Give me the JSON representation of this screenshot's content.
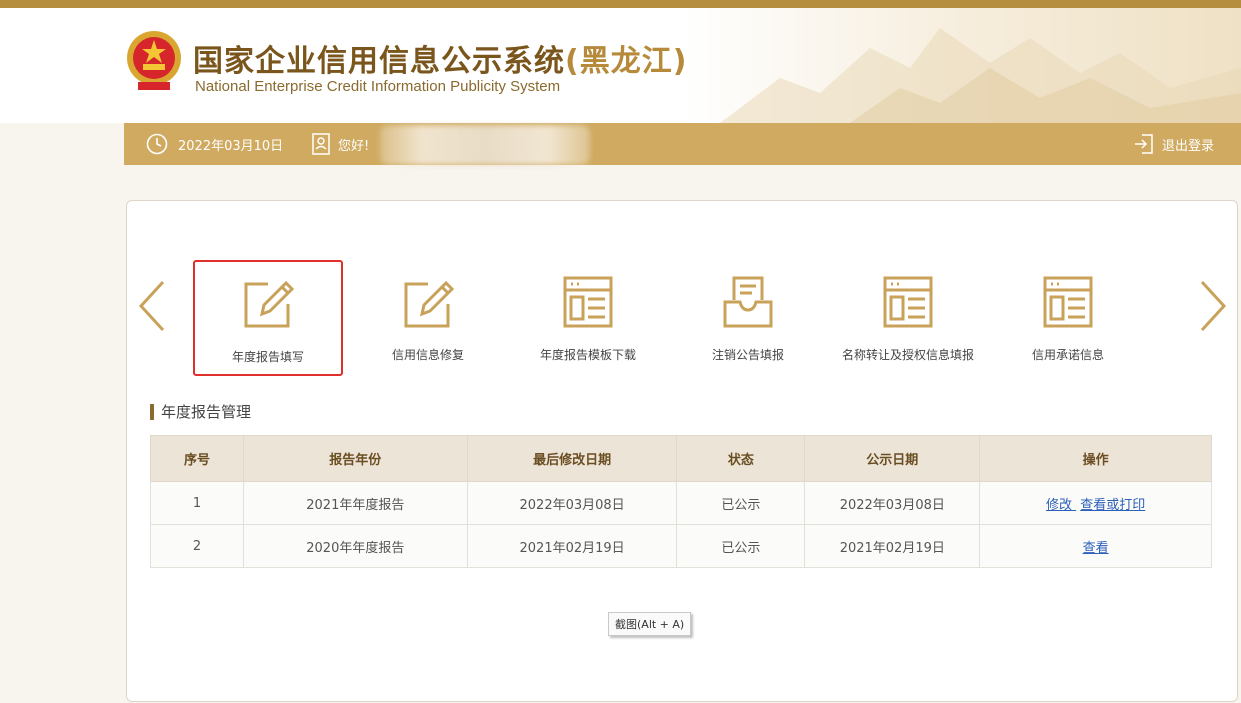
{
  "header": {
    "title_main": "国家企业信用信息公示系统",
    "title_region": "(黑龙江)",
    "title_en": "National Enterprise Credit Information Publicity System"
  },
  "topbar": {
    "date": "2022年03月10日",
    "greeting": "您好!",
    "logout_label": "退出登录"
  },
  "nav": {
    "items": [
      {
        "label": "年度报告填写",
        "icon": "pencil-edit-icon",
        "active": true
      },
      {
        "label": "信用信息修复",
        "icon": "pencil-edit-icon"
      },
      {
        "label": "年度报告模板下载",
        "icon": "document-template-icon"
      },
      {
        "label": "注销公告填报",
        "icon": "inbox-tray-icon"
      },
      {
        "label": "名称转让及授权信息填报",
        "icon": "document-template-icon"
      },
      {
        "label": "信用承诺信息",
        "icon": "document-template-icon"
      }
    ]
  },
  "section": {
    "title": "年度报告管理"
  },
  "table": {
    "headers": [
      "序号",
      "报告年份",
      "最后修改日期",
      "状态",
      "公示日期",
      "操作"
    ],
    "rows": [
      {
        "no": "1",
        "year": "2021年年度报告",
        "modified": "2022年03月08日",
        "status": "已公示",
        "published": "2022年03月08日",
        "actions": [
          "修改",
          "查看或打印"
        ]
      },
      {
        "no": "2",
        "year": "2020年年度报告",
        "modified": "2021年02月19日",
        "status": "已公示",
        "published": "2021年02月19日",
        "actions": [
          "查看"
        ]
      }
    ]
  },
  "tooltip": {
    "text": "截图(Alt + A)"
  },
  "colors": {
    "gold": "#cfaa60",
    "brown": "#7a561c",
    "link": "#2b5fb8",
    "highlight": "#e0302d"
  }
}
